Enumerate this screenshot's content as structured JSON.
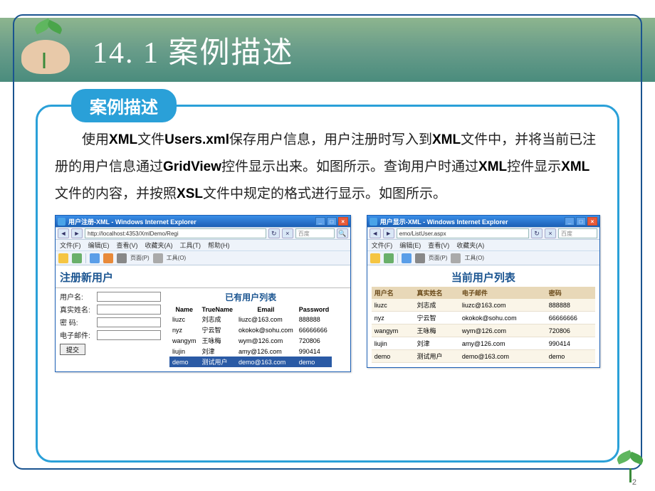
{
  "title": "14. 1  案例描述",
  "badge": "案例描述",
  "description": "使用<b>XML</b>文件<b>Users.xml</b>保存用户信息，用户注册时写入到<b>XML</b>文件中，并将当前已注册的用户信息通过<b>GridView</b>控件显示出来。如图所示。查询用户时通过<b>XML</b>控件显示<b>XML</b>文件的内容，并按照<b>XSL</b>文件中规定的格式进行显示。如图所示。",
  "page_number": "2",
  "ie_left": {
    "window_title": "用户注册-XML - Windows Internet Explorer",
    "url": "http://localhost:4353/XmlDemo/Regi",
    "search_placeholder": "百度",
    "menu": [
      "文件(F)",
      "编辑(E)",
      "查看(V)",
      "收藏夹(A)",
      "工具(T)",
      "帮助(H)"
    ],
    "toolbar_labels": {
      "page": "页面(P)",
      "tools": "工具(O)"
    },
    "reg_title": "注册新用户",
    "form_labels": {
      "username": "用户名:",
      "truename": "真实姓名:",
      "password": "密 码:",
      "email": "电子邮件:"
    },
    "submit": "提交",
    "grid_title": "已有用户列表",
    "grid_headers": [
      "Name",
      "TrueName",
      "Email",
      "Password"
    ],
    "grid_rows": [
      [
        "liuzc",
        "刘志成",
        "liuzc@163.com",
        "888888"
      ],
      [
        "nyz",
        "宁云智",
        "okokok@sohu.com",
        "66666666"
      ],
      [
        "wangym",
        "王咏梅",
        "wym@126.com",
        "720806"
      ],
      [
        "liujin",
        "刘津",
        "amy@126.com",
        "990414"
      ],
      [
        "demo",
        "测试用户",
        "demo@163.com",
        "demo"
      ]
    ]
  },
  "ie_right": {
    "window_title": "用户显示-XML - Windows Internet Explorer",
    "url": "emo/ListUser.aspx",
    "search_placeholder": "百度",
    "menu": [
      "文件(F)",
      "编辑(E)",
      "查看(V)",
      "收藏夹(A)"
    ],
    "toolbar_labels": {
      "page": "页面(P)",
      "tools": "工具(O)"
    },
    "list_title": "当前用户列表",
    "headers": [
      "用户名",
      "真实姓名",
      "电子邮件",
      "密码"
    ],
    "rows": [
      [
        "liuzc",
        "刘志成",
        "liuzc@163.com",
        "888888"
      ],
      [
        "nyz",
        "宁云智",
        "okokok@sohu.com",
        "66666666"
      ],
      [
        "wangym",
        "王咏梅",
        "wym@126.com",
        "720806"
      ],
      [
        "liujin",
        "刘津",
        "amy@126.com",
        "990414"
      ],
      [
        "demo",
        "测试用户",
        "demo@163.com",
        "demo"
      ]
    ]
  }
}
